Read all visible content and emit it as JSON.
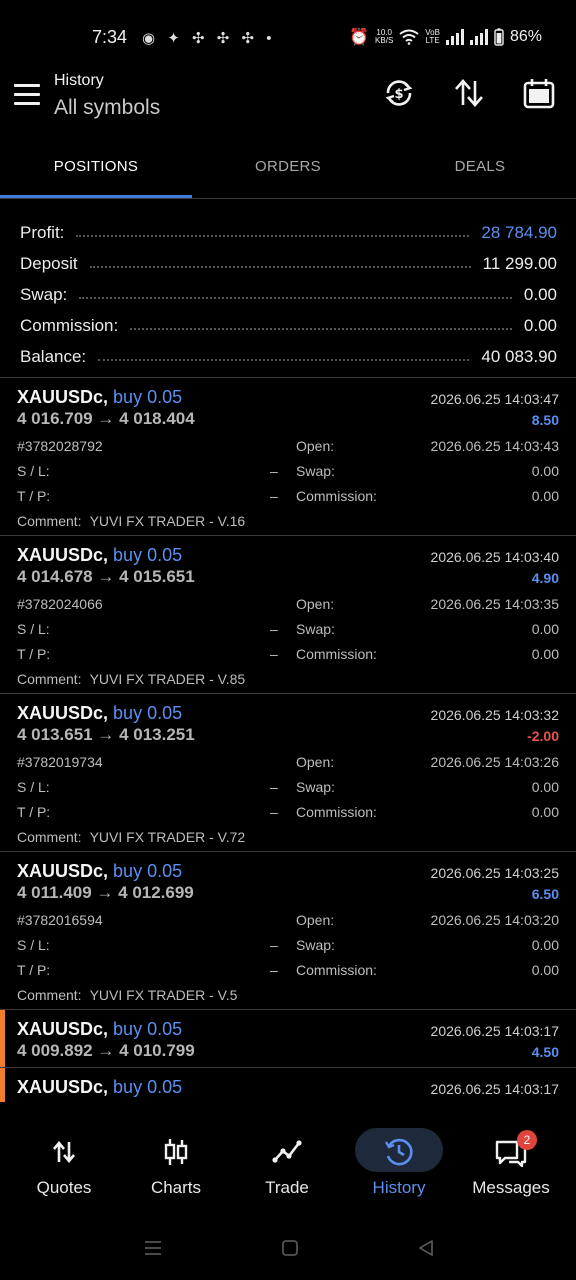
{
  "status_bar": {
    "time": "7:34",
    "left_icons": "◉ ✦ ✣ ✣ ✣ •",
    "net_speed_top": "10.0",
    "net_speed_unit": "KB/S",
    "volte_top": "VoB",
    "volte_bottom": "LTE",
    "battery": "86%"
  },
  "header": {
    "title": "History",
    "subtitle": "All symbols"
  },
  "tabs": [
    {
      "label": "POSITIONS",
      "active": true
    },
    {
      "label": "ORDERS",
      "active": false
    },
    {
      "label": "DEALS",
      "active": false
    }
  ],
  "summary": {
    "profit_label": "Profit:",
    "profit_value": "28 784.90",
    "deposit_label": "Deposit",
    "deposit_value": "11 299.00",
    "swap_label": "Swap:",
    "swap_value": "0.00",
    "commission_label": "Commission:",
    "commission_value": "0.00",
    "balance_label": "Balance:",
    "balance_value": "40 083.90"
  },
  "labels": {
    "open": "Open:",
    "swap": "Swap:",
    "commission": "Commission:",
    "sl": "S / L:",
    "tp": "T / P:",
    "comment": "Comment:",
    "dash": "–"
  },
  "deals": [
    {
      "symbol": "XAUUSDc,",
      "type": "buy 0.05",
      "price": "4 016.709 → 4 018.404",
      "close_time": "2026.06.25 14:03:47",
      "profit": "8.50",
      "ticket": "#3782028792",
      "open_time": "2026.06.25 14:03:43",
      "swap": "0.00",
      "commission": "0.00",
      "comment": "YUVI FX TRADER - V.16"
    },
    {
      "symbol": "XAUUSDc,",
      "type": "buy 0.05",
      "price": "4 014.678 → 4 015.651",
      "close_time": "2026.06.25 14:03:40",
      "profit": "4.90",
      "ticket": "#3782024066",
      "open_time": "2026.06.25 14:03:35",
      "swap": "0.00",
      "commission": "0.00",
      "comment": "YUVI FX TRADER - V.85"
    },
    {
      "symbol": "XAUUSDc,",
      "type": "buy 0.05",
      "price": "4 013.651 → 4 013.251",
      "close_time": "2026.06.25 14:03:32",
      "profit": "-2.00",
      "ticket": "#3782019734",
      "open_time": "2026.06.25 14:03:26",
      "swap": "0.00",
      "commission": "0.00",
      "comment": "YUVI FX TRADER - V.72"
    },
    {
      "symbol": "XAUUSDc,",
      "type": "buy 0.05",
      "price": "4 011.409 → 4 012.699",
      "close_time": "2026.06.25 14:03:25",
      "profit": "6.50",
      "ticket": "#3782016594",
      "open_time": "2026.06.25 14:03:20",
      "swap": "0.00",
      "commission": "0.00",
      "comment": "YUVI FX TRADER - V.5"
    },
    {
      "symbol": "XAUUSDc,",
      "type": "buy 0.05",
      "price": "4 009.892 → 4 010.799",
      "close_time": "2026.06.25 14:03:17",
      "profit": "4.50"
    },
    {
      "symbol": "XAUUSDc,",
      "type": "buy 0.05",
      "close_time": "2026.06.25 14:03:17"
    }
  ],
  "bottom_nav": [
    {
      "label": "Quotes",
      "icon": "quotes-arrows-icon"
    },
    {
      "label": "Charts",
      "icon": "candlestick-icon"
    },
    {
      "label": "Trade",
      "icon": "trend-line-icon"
    },
    {
      "label": "History",
      "icon": "history-clock-icon",
      "active": true
    },
    {
      "label": "Messages",
      "icon": "chat-bubbles-icon",
      "badge": "2"
    }
  ],
  "colors": {
    "accent": "#5b8ff0",
    "tab_indicator": "#3d7bdc",
    "negative": "#e5544e",
    "marker": "#f07d2a",
    "badge": "#e0443e"
  }
}
